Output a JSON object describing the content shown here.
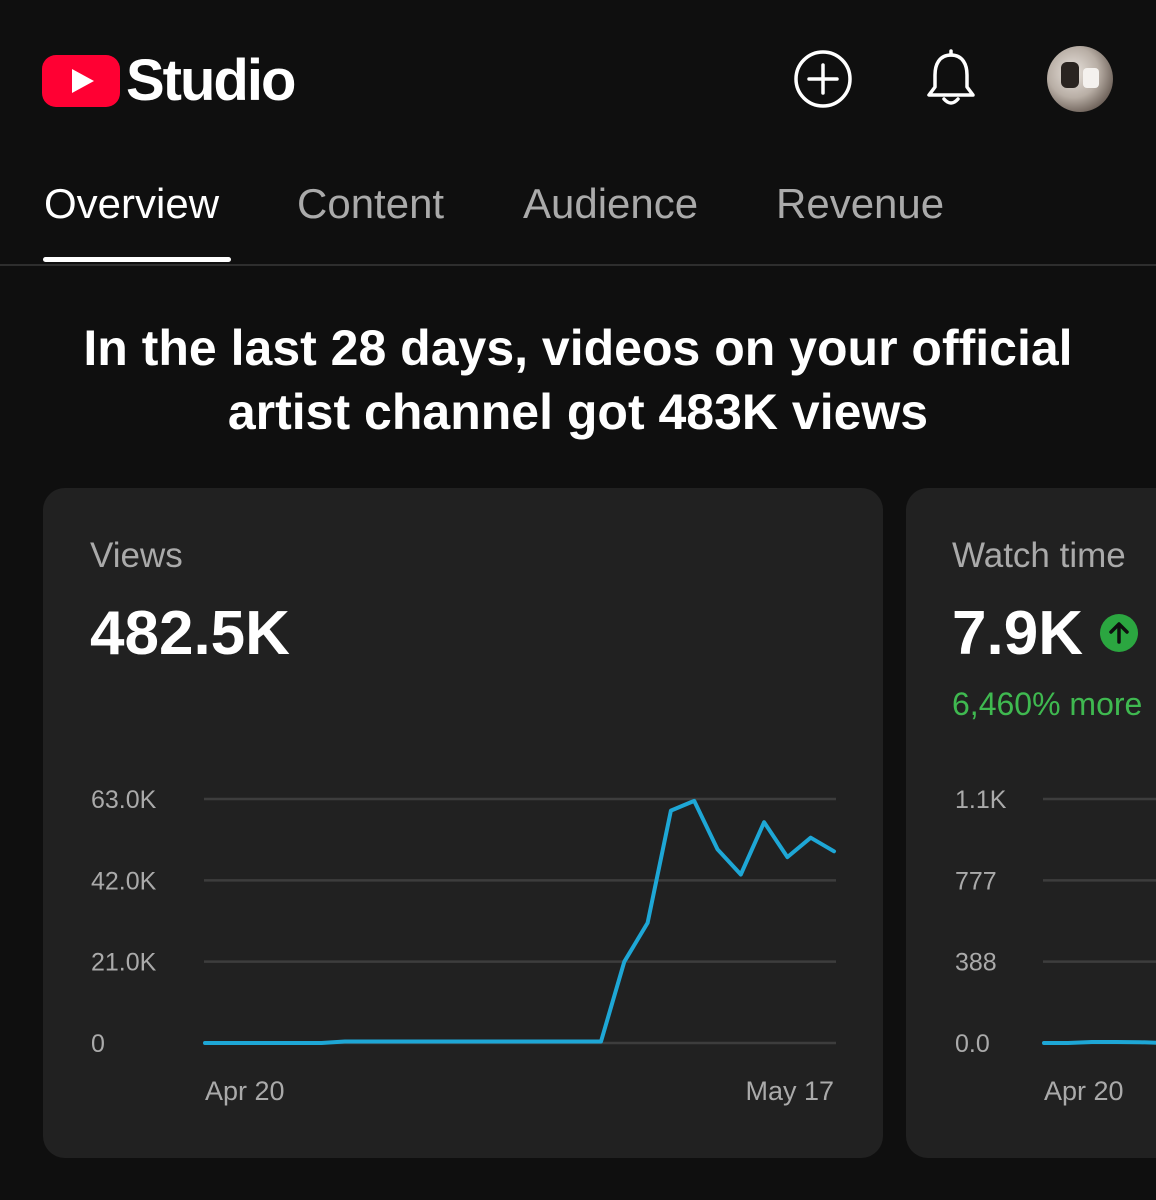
{
  "header": {
    "logo_text": "Studio",
    "icons": [
      "create-icon",
      "bell-icon"
    ],
    "accent_color": "#ff0033"
  },
  "tabs": [
    {
      "label": "Overview",
      "active": true
    },
    {
      "label": "Content",
      "active": false
    },
    {
      "label": "Audience",
      "active": false
    },
    {
      "label": "Revenue",
      "active": false
    }
  ],
  "headline": {
    "line1": "In the last 28 days, videos on your official",
    "line2": "artist channel got 483K views"
  },
  "cards": [
    {
      "title": "Views",
      "value": "482.5K",
      "chart_data": {
        "type": "line",
        "y_ticks": [
          "63.0K",
          "42.0K",
          "21.0K",
          "0"
        ],
        "ylim": [
          0,
          63000
        ],
        "x_labels": [
          "Apr 20",
          "May 17"
        ],
        "series_color": "#1ea7d6",
        "x": [
          1,
          2,
          3,
          4,
          5,
          6,
          7,
          8,
          9,
          10,
          11,
          12,
          13,
          14,
          15,
          16,
          17,
          18,
          19,
          20,
          21,
          22,
          23,
          24,
          25,
          26,
          27,
          28
        ],
        "values": [
          0,
          0,
          0,
          0,
          0,
          0,
          400,
          400,
          400,
          400,
          400,
          400,
          400,
          400,
          400,
          400,
          400,
          400,
          21000,
          31000,
          60000,
          62500,
          50000,
          43500,
          57000,
          48000,
          53000,
          49500
        ]
      }
    },
    {
      "title": "Watch time",
      "value": "7.9K",
      "change_text": "6,460% more",
      "change_color": "#3fb950",
      "chart_data": {
        "type": "line",
        "y_ticks": [
          "1.1K",
          "777",
          "388",
          "0.0"
        ],
        "ylim": [
          0,
          1165
        ],
        "x_labels": [
          "Apr 20"
        ],
        "series_color": "#1ea7d6",
        "x": [
          1,
          2,
          3,
          4,
          5,
          6
        ],
        "values": [
          0,
          0,
          5,
          5,
          4,
          0
        ]
      }
    }
  ]
}
